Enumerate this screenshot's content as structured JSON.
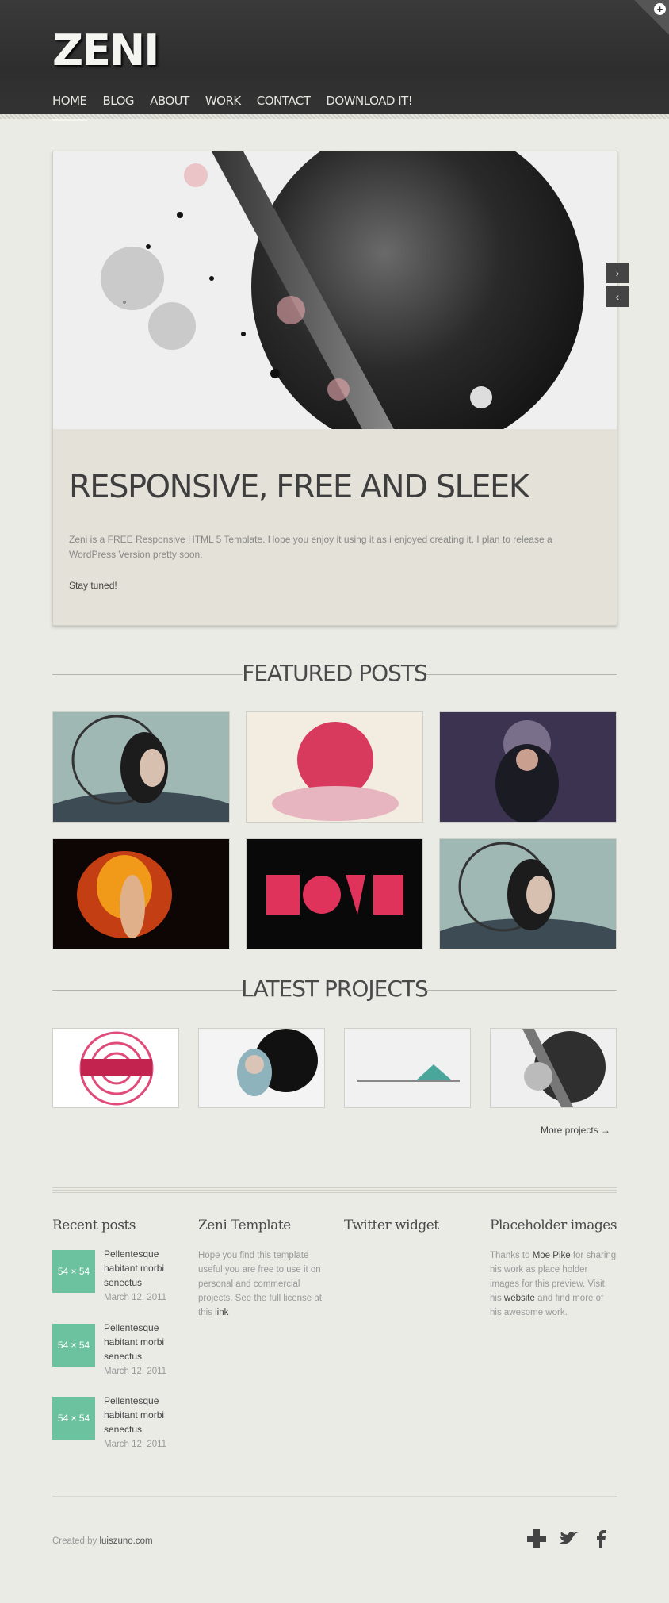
{
  "header": {
    "logo": "ZENI",
    "nav": [
      "HOME",
      "BLOG",
      "ABOUT",
      "WORK",
      "CONTACT",
      "DOWNLOAD IT!"
    ]
  },
  "slider": {
    "title": "RESPONSIVE, FREE AND SLEEK",
    "text": "Zeni is a FREE Responsive HTML 5 Template. Hope you enjoy it using it as i enjoyed creating it. I plan to release a WordPress Version pretty soon.",
    "tagline": "Stay tuned!",
    "next_icon": "chevron-right-icon",
    "prev_icon": "chevron-left-icon"
  },
  "featured": {
    "heading": "FEATURED POSTS"
  },
  "projects": {
    "heading": "LATEST PROJECTS",
    "more": "More projects →"
  },
  "footer_widgets": {
    "recent": {
      "title": "Recent posts",
      "posts": [
        {
          "thumb": "54 × 54",
          "title": "Pellentesque habitant morbi senectus",
          "date": "March 12, 2011"
        },
        {
          "thumb": "54 × 54",
          "title": "Pellentesque habitant morbi senectus",
          "date": "March 12, 2011"
        },
        {
          "thumb": "54 × 54",
          "title": "Pellentesque habitant morbi senectus",
          "date": "March 12, 2011"
        }
      ]
    },
    "template": {
      "title": "Zeni Template",
      "text": "Hope you find this template useful you are free to use it on personal and commercial projects. See the full license at this",
      "link": "link"
    },
    "twitter": {
      "title": "Twitter widget"
    },
    "placeholder": {
      "title": "Placeholder images",
      "pre": "Thanks to",
      "author": "Moe Pike",
      "mid": "for sharing his work as place holder images for this preview. Visit his",
      "website": "website",
      "post": "and find more of his awesome work."
    }
  },
  "footer": {
    "created_by": "Created by",
    "author": "luiszuno.com",
    "social": [
      "plus-icon",
      "twitter-bird-icon",
      "facebook-icon"
    ]
  },
  "colors": {
    "accent_thumb": "#6cc19e",
    "header_bg": "#333333",
    "page_bg": "#ebebe6"
  }
}
